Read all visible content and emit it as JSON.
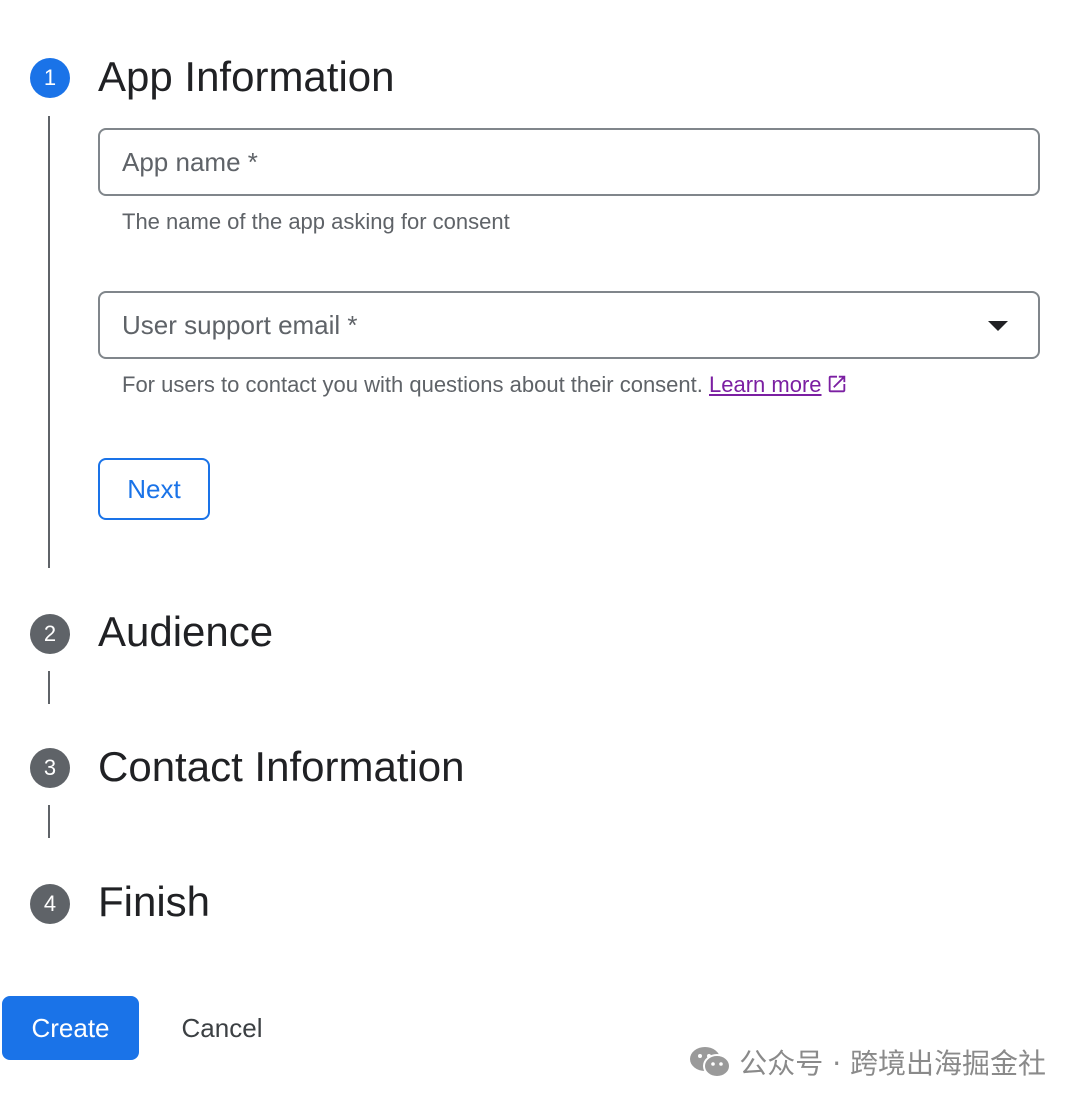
{
  "steps": [
    {
      "number": "1",
      "title": "App Information"
    },
    {
      "number": "2",
      "title": "Audience"
    },
    {
      "number": "3",
      "title": "Contact Information"
    },
    {
      "number": "4",
      "title": "Finish"
    }
  ],
  "app_info": {
    "app_name_label": "App name *",
    "app_name_value": "",
    "app_name_hint": "The name of the app asking for consent",
    "support_email_label": "User support email *",
    "support_email_hint": "For users to contact you with questions about their consent.",
    "learn_more_label": "Learn more",
    "next_label": "Next"
  },
  "footer": {
    "create_label": "Create",
    "cancel_label": "Cancel"
  },
  "watermark": {
    "text": "公众号 · 跨境出海掘金社"
  },
  "colors": {
    "accent": "#1a73e8",
    "inactive_step": "#5f6368",
    "link": "#7b1fa2"
  }
}
